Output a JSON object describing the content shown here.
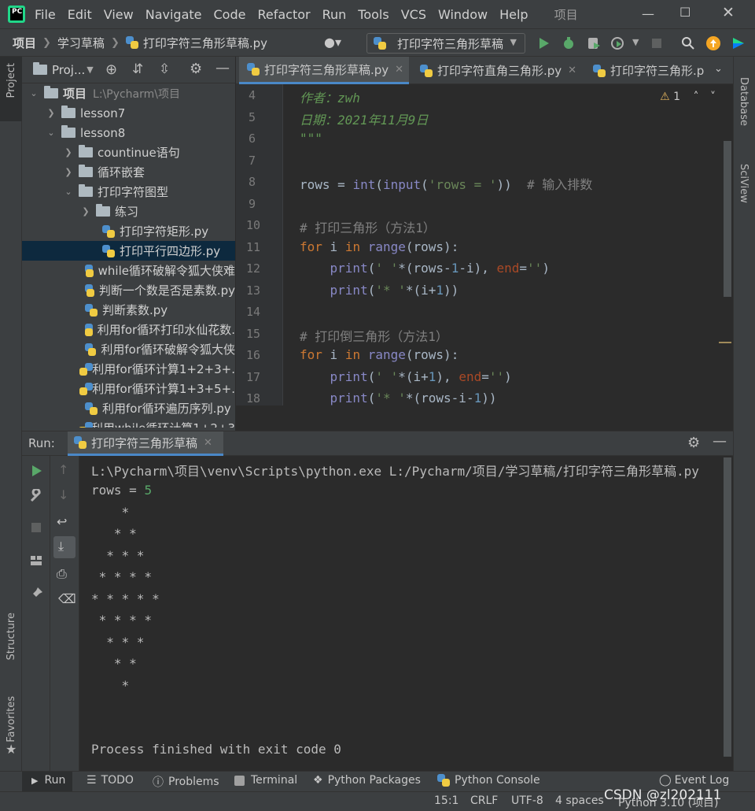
{
  "menubar": {
    "logo": "PC",
    "items": [
      "File",
      "Edit",
      "View",
      "Navigate",
      "Code",
      "Refactor",
      "Run",
      "Tools",
      "VCS",
      "Window",
      "Help"
    ],
    "window_title": "项目"
  },
  "navbar": {
    "breadcrumbs": [
      "项目",
      "学习草稿",
      "打印字符三角形草稿.py"
    ],
    "run_config": "打印字符三角形草稿"
  },
  "project_panel": {
    "title": "Proj...",
    "root_label": "项目",
    "root_path": "L:\\Pycharm\\项目",
    "rows": [
      {
        "label": "lesson7"
      },
      {
        "label": "lesson8"
      },
      {
        "label": "countinue语句"
      },
      {
        "label": "循环嵌套"
      },
      {
        "label": "打印字符图型"
      },
      {
        "label": "练习"
      },
      {
        "label": "打印字符矩形.py"
      },
      {
        "label": "打印平行四边形.py"
      },
      {
        "label": "while循环破解令狐大侠难"
      },
      {
        "label": "判断一个数是否是素数.py"
      },
      {
        "label": "判断素数.py"
      },
      {
        "label": "利用for循环打印水仙花数."
      },
      {
        "label": "利用for循环破解令狐大侠"
      },
      {
        "label": "利用for循环计算1+2+3+."
      },
      {
        "label": "利用for循环计算1+3+5+."
      },
      {
        "label": "利用for循环遍历序列.py"
      },
      {
        "label": "利用while循环计算1+2+3"
      }
    ]
  },
  "left_stripe": {
    "project": "Project",
    "structure": "Structure",
    "favorites": "Favorites"
  },
  "right_stripe": {
    "database": "Database",
    "sciview": "SciView"
  },
  "editor": {
    "tabs": [
      "打印字符三角形草稿.py",
      "打印字符直角三角形.py",
      "打印字符三角形.p"
    ],
    "inspection_count": "1",
    "line_numbers": [
      "4",
      "5",
      "6",
      "7",
      "8",
      "9",
      "10",
      "11",
      "12",
      "13",
      "14",
      "15",
      "16",
      "17",
      "18"
    ],
    "code": {
      "l4": "作者：zwh",
      "l5": "日期：2021年11月9日",
      "l6": "\"\"\"",
      "l8a": "rows = ",
      "l8b": "int",
      "l8c": "(",
      "l8d": "input",
      "l8e": "(",
      "l8f": "'rows = '",
      "l8g": "))  ",
      "l8h": "# 输入排数",
      "l10": "# 打印三角形（方法1）",
      "for_kw": "for",
      "for_i": " i ",
      "in_kw": "in",
      "range_fn": "range",
      "rows_arg": "(rows):",
      "print_fn": "print",
      "l12a": "(",
      "l12b": "' '",
      "l12c": "*(rows-",
      "l12d": "1",
      "l12e": "-i), ",
      "l12f": "end",
      "l12g": "=",
      "l12h": "''",
      "l12i": ")",
      "l13b": "'* '",
      "l13c": "*(i+",
      "l13d": "1",
      "l13e": "))",
      "l15": "# 打印倒三角形（方法1）",
      "l17c": "*(i+",
      "l17e": "), ",
      "l18c": "*(rows-i-",
      "l18e": "))"
    }
  },
  "run_window": {
    "label": "Run:",
    "tab": "打印字符三角形草稿",
    "command": "L:\\Pycharm\\项目\\venv\\Scripts\\python.exe L:/Pycharm/项目/学习草稿/打印字符三角形草稿.py",
    "prompt": "rows = ",
    "input_value": "5",
    "output_lines": [
      "    *",
      "   * *",
      "  * * *",
      " * * * *",
      "* * * * *",
      " * * * *",
      "  * * *",
      "   * *",
      "    *"
    ],
    "exit_message": "Process finished with exit code 0"
  },
  "bottom_tools": [
    "Run",
    "TODO",
    "Problems",
    "Terminal",
    "Python Packages",
    "Python Console",
    "Event Log"
  ],
  "status_bar": {
    "position": "15:1",
    "line_sep": "CRLF",
    "encoding": "UTF-8",
    "indent": "4 spaces",
    "interpreter": "Python 3.10 (项目)"
  },
  "watermark": "CSDN @zl202111",
  "colors": {
    "accent": "#4a88c7",
    "run_green": "#59a869",
    "keyword": "#cc7832",
    "string": "#6a8759",
    "number": "#6897bb"
  }
}
